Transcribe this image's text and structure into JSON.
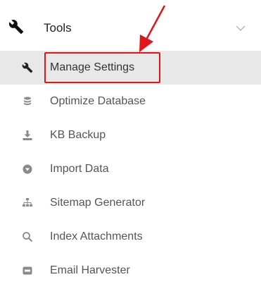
{
  "header": {
    "label": "Tools",
    "icon": "wrench-icon",
    "expand_icon": "chevron-down-icon"
  },
  "menu_items": [
    {
      "label": "Manage Settings",
      "icon": "wrench-icon",
      "active": true
    },
    {
      "label": "Optimize Database",
      "icon": "database-icon",
      "active": false
    },
    {
      "label": "KB Backup",
      "icon": "download-icon",
      "active": false
    },
    {
      "label": "Import Data",
      "icon": "import-circle-icon",
      "active": false
    },
    {
      "label": "Sitemap Generator",
      "icon": "sitemap-icon",
      "active": false
    },
    {
      "label": "Index Attachments",
      "icon": "search-icon",
      "active": false
    },
    {
      "label": "Email Harvester",
      "icon": "email-box-icon",
      "active": false
    }
  ],
  "colors": {
    "active_background": "#e8e8e8",
    "annotation_red": "#e0141c",
    "icon_gray": "#8a8a8a",
    "text_dark": "#222222",
    "text_gray": "#555555"
  }
}
